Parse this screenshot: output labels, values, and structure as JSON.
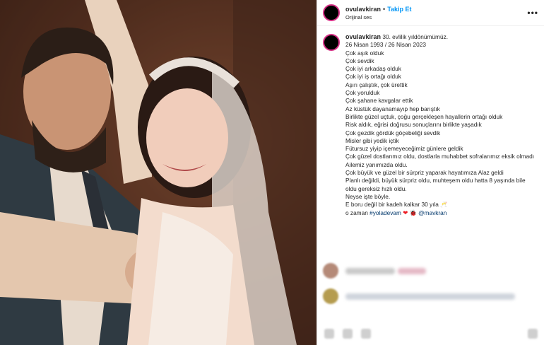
{
  "post": {
    "username": "ovulavkiran",
    "separator": "•",
    "follow_label": "Takip Et",
    "audio": "Orijinal ses",
    "more": "•••"
  },
  "caption": {
    "username": "ovulavkiran",
    "first_line": " 30. evlilik yıldönümümüz.",
    "lines": [
      "26 Nisan 1993 / 26 Nisan 2023",
      "Çok aşık olduk",
      "Çok sevdik",
      "Çok iyi arkadaş olduk",
      "Çok iyi iş ortağı olduk",
      "Aşırı çalıştık, çok ürettik",
      "Çok yorulduk",
      "Çok şahane kavgalar ettik",
      "Az küstük dayanamayıp hep barıştık",
      "Birlikte güzel uçtuk, çoğu gerçekleşen hayallerin ortağı olduk",
      "Risk aldık, eğrisi doğrusu sonuçlarını birlikte yaşadık",
      "Çok gezdik gördük göçebeliği sevdik",
      "Misler gibi yedik içtik",
      "Fütursuz yiyip içemeyeceğimiz günlere geldik"
    ],
    "wrap_line_1": "Çok güzel dostlarımız oldu, dostlarla muhabbet sofralarımız eksik olmadı",
    "lines_b": [
      "Ailemiz yanımızda oldu.",
      "Çok büyük ve güzel bir sürpriz yaparak hayatımıza Alaz geldi"
    ],
    "wrap_line_2": "Planlı değildi, büyük sürpriz oldu, muhteşem oldu hatta 8 yaşında bile oldu gereksiz hızlı oldu.",
    "lines_c": [
      "Neyse işte böyle.",
      "E boru değil bir kadeh kalkar 30 yıla 🥂"
    ],
    "last_prefix": "o zaman ",
    "hashtag": "#yoladevam",
    "heart": "❤",
    "bug": "🐞",
    "mention": "@mavkran"
  },
  "colors": {
    "accent": "#0095f6",
    "text": "#262626",
    "story_ring": "#d52f85"
  }
}
